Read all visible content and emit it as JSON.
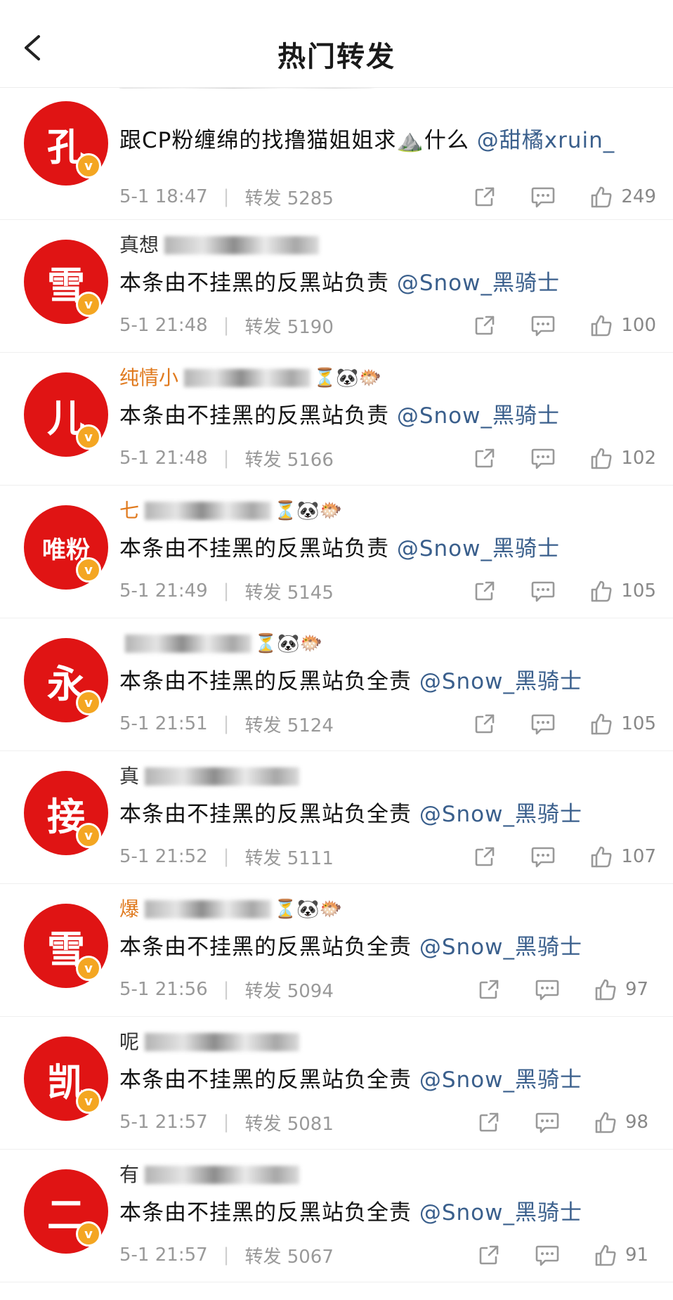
{
  "header": {
    "title": "热门转发"
  },
  "rows": [
    {
      "avatar": "孔",
      "user": "",
      "userColor": "gray",
      "content": "跟CP粉缠绵的找撸猫姐姐求⛰️什么 ",
      "mention": "@甜橘xruin_",
      "time": "5-1 18:47",
      "repost": "转发 5285",
      "likes": "249"
    },
    {
      "avatar": "雪",
      "user": "真想",
      "userColor": "gray",
      "content": "本条由不挂黑的反黑站负责 ",
      "mention": "@Snow_黑骑士",
      "time": "5-1 21:48",
      "repost": "转发 5190",
      "likes": "100"
    },
    {
      "avatar": "儿",
      "user": "纯情小",
      "userColor": "orange",
      "content": "本条由不挂黑的反黑站负责 ",
      "mention": "@Snow_黑骑士",
      "time": "5-1 21:48",
      "repost": "转发 5166",
      "likes": "102"
    },
    {
      "avatar": "唯粉",
      "user": "七",
      "userColor": "orange",
      "content": "本条由不挂黑的反黑站负责 ",
      "mention": "@Snow_黑骑士",
      "time": "5-1 21:49",
      "repost": "转发 5145",
      "likes": "105"
    },
    {
      "avatar": "永",
      "user": "",
      "userColor": "orange",
      "content": "本条由不挂黑的反黑站负全责 ",
      "mention": "@Snow_黑骑士",
      "time": "5-1 21:51",
      "repost": "转发 5124",
      "likes": "105"
    },
    {
      "avatar": "接",
      "user": "真",
      "userColor": "gray",
      "content": "本条由不挂黑的反黑站负全责 ",
      "mention": "@Snow_黑骑士",
      "time": "5-1 21:52",
      "repost": "转发 5111",
      "likes": "107"
    },
    {
      "avatar": "雪",
      "user": "爆",
      "userColor": "orange",
      "content": "本条由不挂黑的反黑站负全责 ",
      "mention": "@Snow_黑骑士",
      "time": "5-1 21:56",
      "repost": "转发 5094",
      "likes": "97"
    },
    {
      "avatar": "凯",
      "user": "呢",
      "userColor": "gray",
      "content": "本条由不挂黑的反黑站负全责 ",
      "mention": "@Snow_黑骑士",
      "time": "5-1 21:57",
      "repost": "转发 5081",
      "likes": "98"
    },
    {
      "avatar": "二",
      "user": "有",
      "userColor": "gray",
      "content": "本条由不挂黑的反黑站负全责 ",
      "mention": "@Snow_黑骑士",
      "time": "5-1 21:57",
      "repost": "转发 5067",
      "likes": "91"
    }
  ],
  "icons": {
    "back": "chevron-left-icon",
    "share": "share-icon",
    "comment": "comment-icon",
    "like": "thumbs-up-icon",
    "badge": "verified-badge-icon"
  }
}
